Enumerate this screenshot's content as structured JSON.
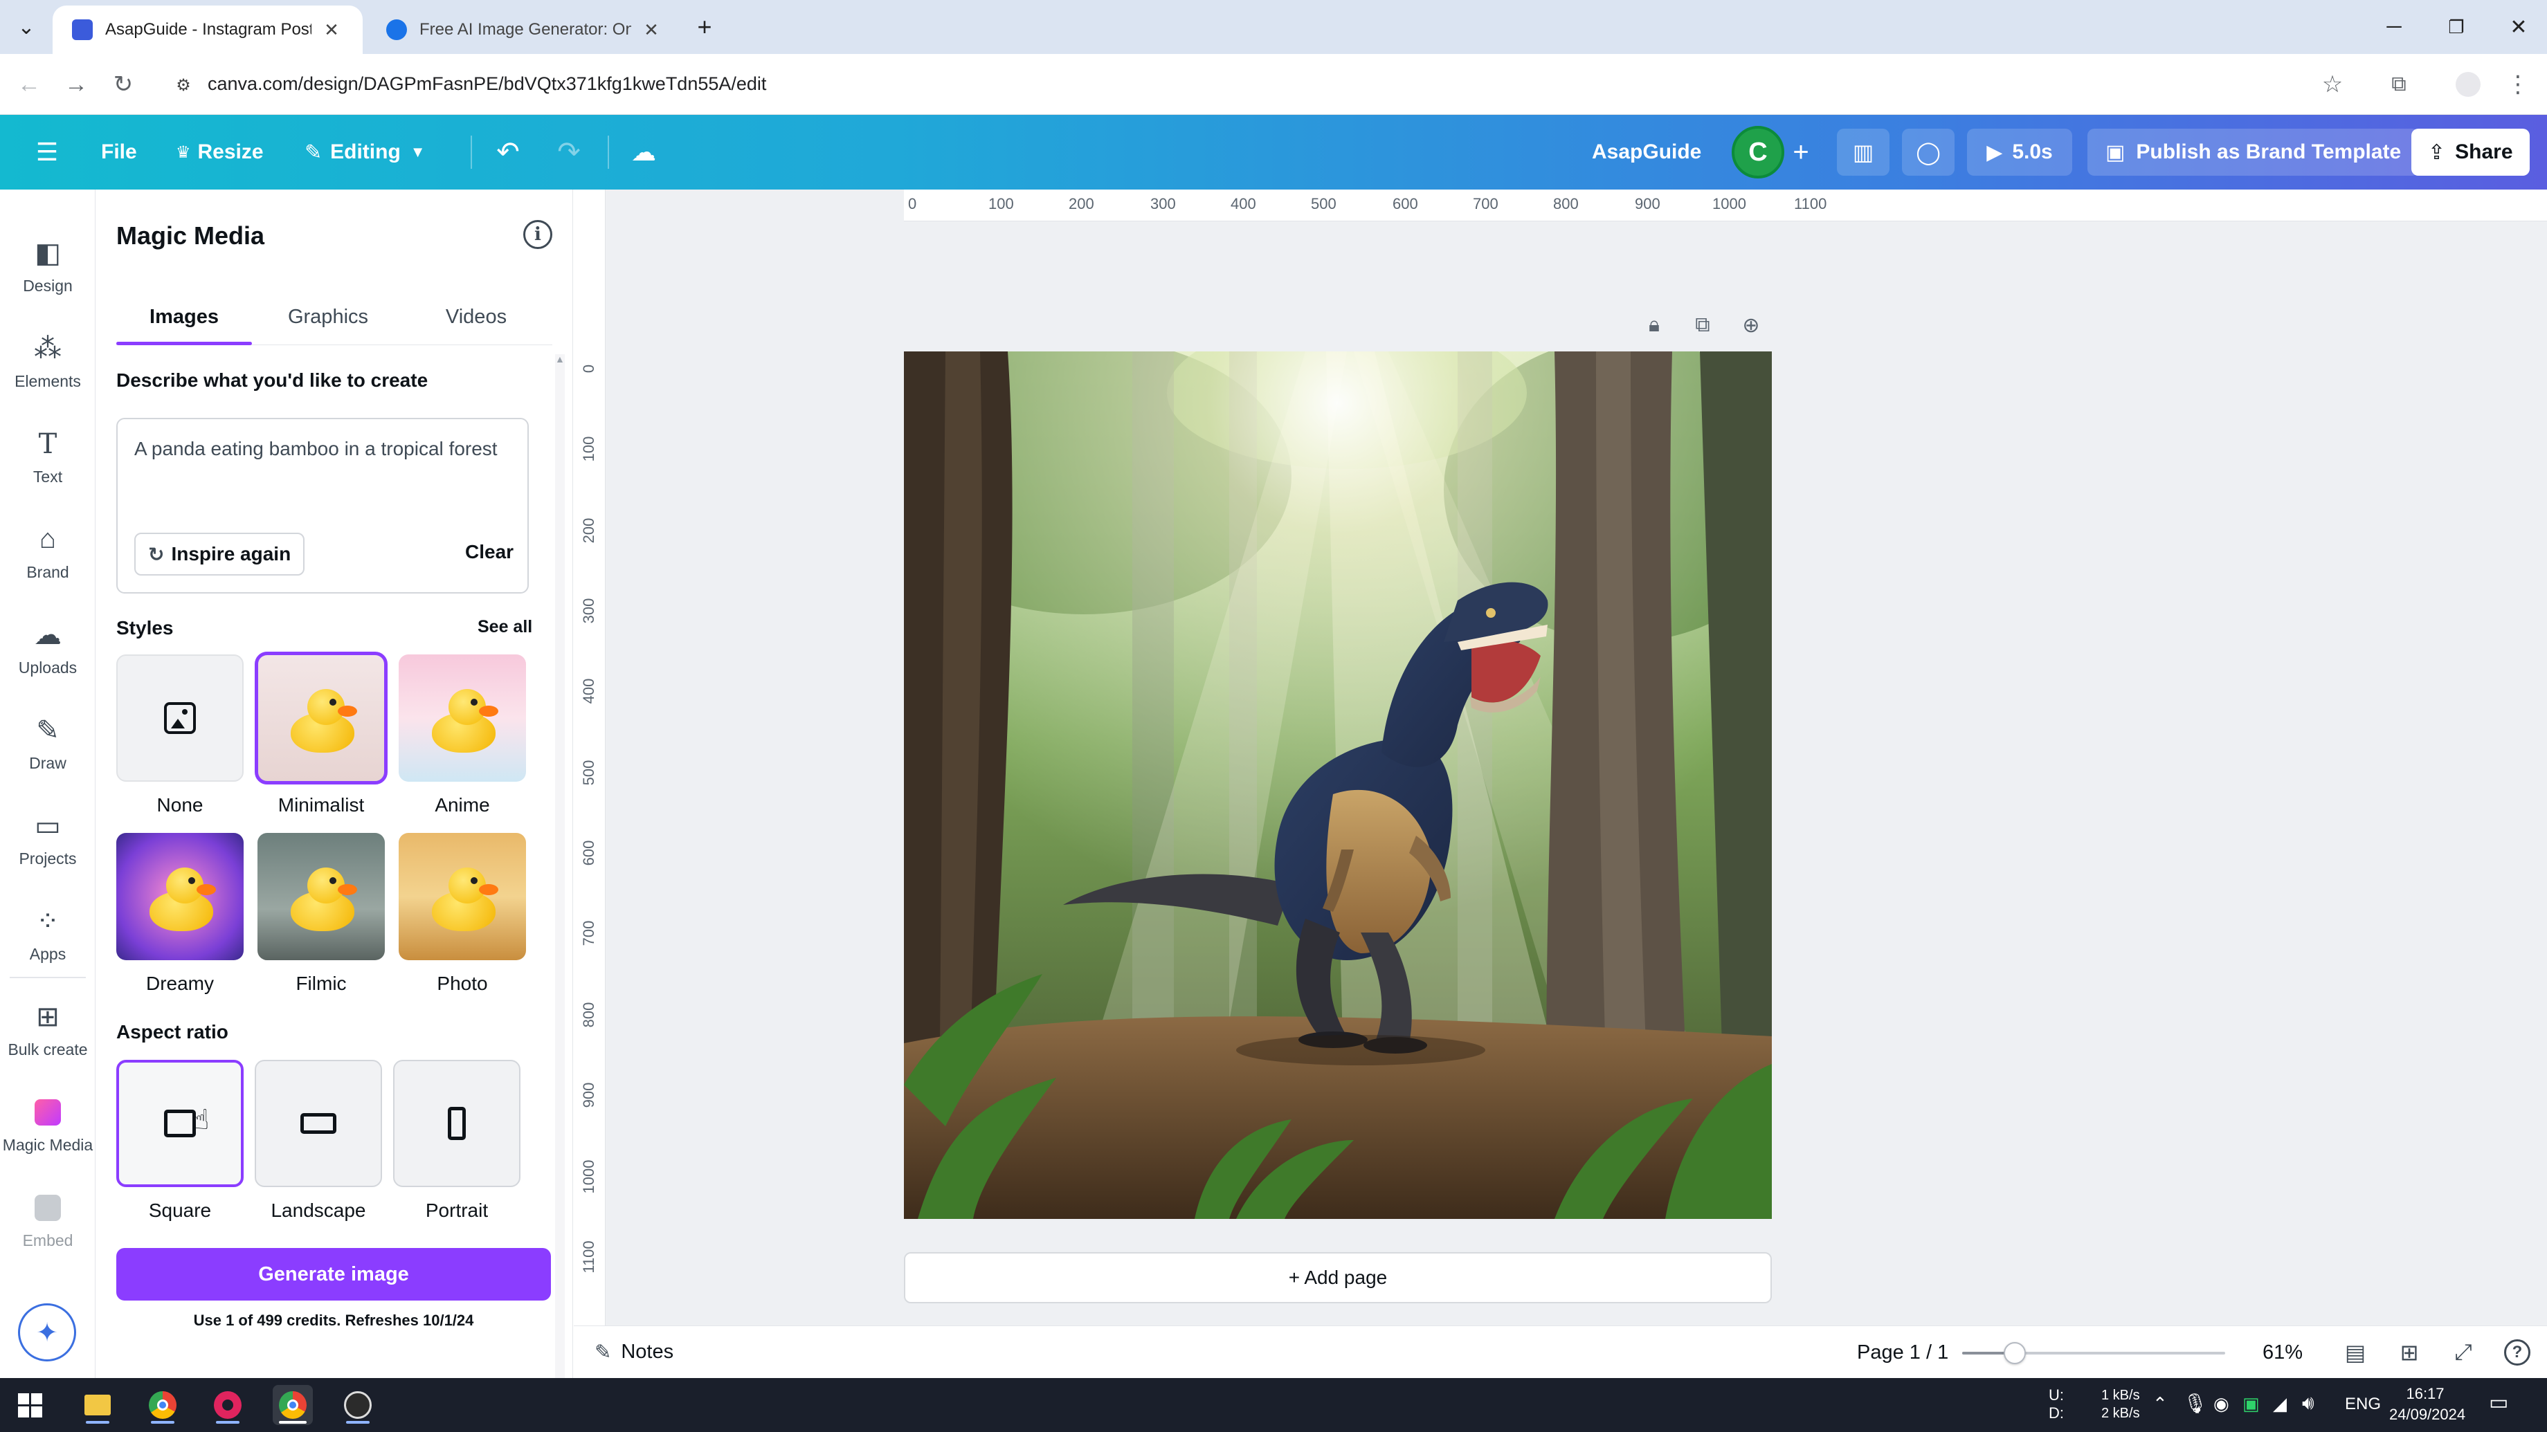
{
  "browser": {
    "tabs": [
      {
        "title": "AsapGuide - Instagram Post",
        "active": true,
        "favicon_color": "#3b5bdb"
      },
      {
        "title": "Free AI Image Generator: Onlin",
        "active": false,
        "favicon_color": "#1a73e8"
      }
    ],
    "url": "canva.com/design/DAGPmFasnPE/bdVQtx371kfg1kweTdn55A/edit"
  },
  "header": {
    "file": "File",
    "resize": "Resize",
    "editing": "Editing",
    "design_name": "AsapGuide",
    "avatar_letter": "C",
    "timer": "5.0s",
    "publish": "Publish as Brand Template",
    "share": "Share"
  },
  "rail": {
    "items": [
      {
        "label": "Design",
        "icon": "design-icon"
      },
      {
        "label": "Elements",
        "icon": "elements-icon"
      },
      {
        "label": "Text",
        "icon": "text-icon"
      },
      {
        "label": "Brand",
        "icon": "brand-icon"
      },
      {
        "label": "Uploads",
        "icon": "uploads-icon"
      },
      {
        "label": "Draw",
        "icon": "draw-icon"
      },
      {
        "label": "Projects",
        "icon": "projects-icon"
      },
      {
        "label": "Apps",
        "icon": "apps-icon"
      },
      {
        "label": "Bulk create",
        "icon": "bulk-create-icon"
      },
      {
        "label": "Magic Media",
        "icon": "magic-media-icon"
      },
      {
        "label": "Embed",
        "icon": "embed-icon"
      }
    ]
  },
  "panel": {
    "title": "Magic Media",
    "tabs": [
      "Images",
      "Graphics",
      "Videos"
    ],
    "describe_label": "Describe what you'd like to create",
    "prompt": "A panda eating bamboo in a tropical forest",
    "inspire": "Inspire again",
    "clear": "Clear",
    "styles_label": "Styles",
    "see_all": "See all",
    "styles": [
      "None",
      "Minimalist",
      "Anime",
      "Dreamy",
      "Filmic",
      "Photo"
    ],
    "aspect_label": "Aspect ratio",
    "aspect_ratios": [
      "Square",
      "Landscape",
      "Portrait"
    ],
    "generate": "Generate image",
    "credits": "Use 1 of 499 credits. Refreshes 10/1/24"
  },
  "canvas": {
    "ruler_top": [
      "0",
      "100",
      "200",
      "300",
      "400",
      "500",
      "600",
      "700",
      "800",
      "900",
      "1000",
      "1100"
    ],
    "ruler_left": [
      "0",
      "100",
      "200",
      "300",
      "400",
      "500",
      "600",
      "700",
      "800",
      "900",
      "1000",
      "1100"
    ],
    "add_page": "+ Add page"
  },
  "footer": {
    "notes": "Notes",
    "page_indicator": "Page 1 / 1",
    "zoom": "61%",
    "zoom_level": 0.61
  },
  "taskbar": {
    "net_up_label": "U:",
    "net_down_label": "D:",
    "net_up": "1 kB/s",
    "net_down": "2 kB/s",
    "lang": "ENG",
    "time": "16:17",
    "date": "24/09/2024"
  },
  "colors": {
    "accent": "#8b3dff",
    "header_start": "#14b9d0",
    "header_end": "#5a5ee0"
  }
}
